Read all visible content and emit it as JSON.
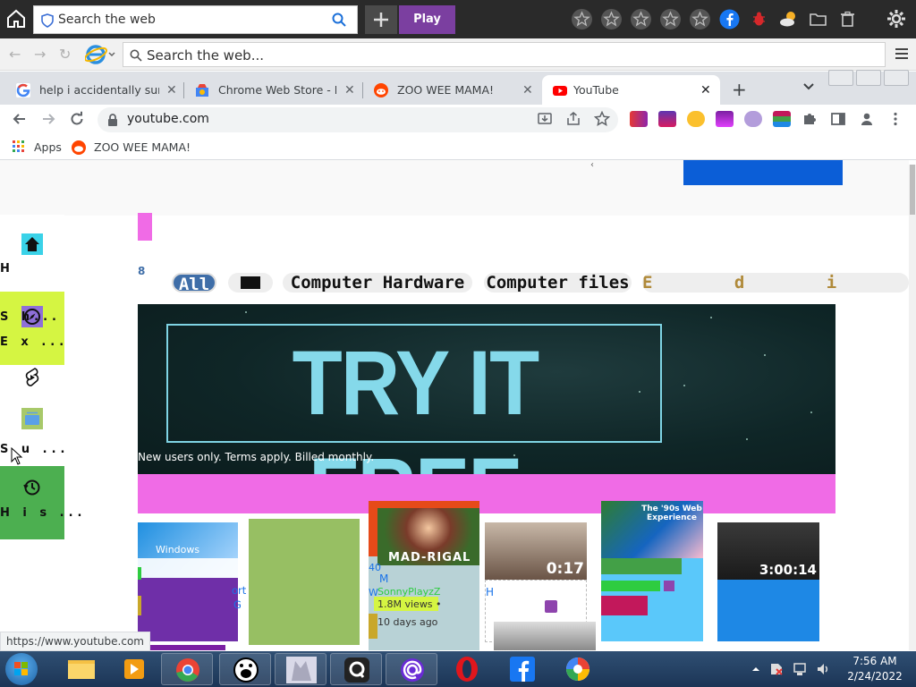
{
  "top_toolbar": {
    "search_placeholder": "Search the web",
    "play_label": "Play"
  },
  "ie_bar": {
    "search_placeholder": "Search the web..."
  },
  "tabs": [
    {
      "title": "help i accidentally summo",
      "favicon": "google-icon"
    },
    {
      "title": "Chrome Web Store - Exte",
      "favicon": "chrome-webstore-icon"
    },
    {
      "title": "ZOO WEE MAMA!",
      "favicon": "reddit-icon"
    },
    {
      "title": "YouTube",
      "favicon": "youtube-icon",
      "active": true
    }
  ],
  "address": {
    "url": "youtube.com"
  },
  "bookmarks": [
    {
      "label": "Apps",
      "icon": "apps-grid-icon"
    },
    {
      "label": "ZOO WEE MAMA!",
      "icon": "reddit-icon"
    }
  ],
  "sidebar": {
    "items": [
      {
        "label": "H",
        "icon": "home-icon"
      },
      {
        "label": "S h...",
        "label2": "E x ...",
        "icon": "compass-icon"
      },
      {
        "label": "",
        "icon": "shorts-icon"
      },
      {
        "label": "S u ...",
        "icon": "subscriptions-icon"
      },
      {
        "label": "H i s ...",
        "icon": "history-icon"
      }
    ]
  },
  "chips": [
    {
      "label": "All",
      "active": true
    },
    {
      "label": "",
      "active": false
    },
    {
      "label": "Computer Hardware",
      "active": false
    },
    {
      "label": "Computer files",
      "active": false
    },
    {
      "label": "E d i t i",
      "active": false
    }
  ],
  "banner": {
    "cta": "TRY IT FREE",
    "fine_print": "New users only. Terms apply. Billed monthly."
  },
  "videos": {
    "mirabel_title": "MAD-RIGAL",
    "channel": "SonnyPlayzZ",
    "views": "1.8M views •",
    "age": "10 days ago",
    "duration_1": "0:17",
    "duration_2": "3:00:14",
    "web_experience": "The '90s Web Experience",
    "windows_label": "Windows",
    "partial_1": "40",
    "partial_2": "M",
    "partial_3": "W",
    "partial_4": "H",
    "partial_5": "ort",
    "partial_6": "G"
  },
  "status_url": "https://www.youtube.com",
  "clock": {
    "time": "7:56 AM",
    "date": "2/24/2022"
  },
  "colors": {
    "play_purple": "#7b3fa0",
    "yt_pink": "#f06be6",
    "yt_red": "#ff0000",
    "banner_text": "#85d9ea",
    "lime": "#d5f542",
    "green_side": "#4caf50"
  }
}
